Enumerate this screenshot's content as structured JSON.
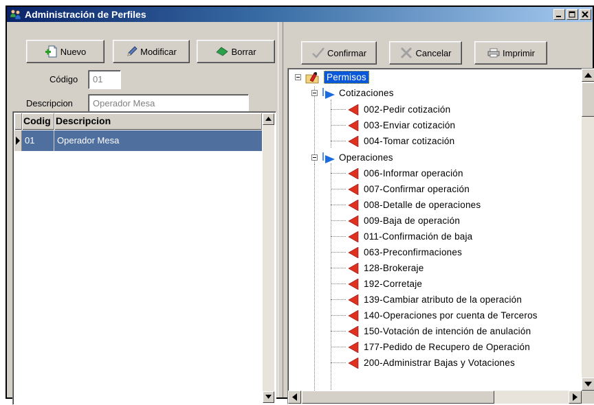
{
  "window": {
    "title": "Administración de Perfiles",
    "title_icon": "users-icon",
    "controls": [
      "minimize-icon",
      "restore-icon",
      "close-icon"
    ]
  },
  "left_toolbar": {
    "nuevo": "Nuevo",
    "modificar": "Modificar",
    "borrar": "Borrar"
  },
  "form": {
    "codigo_label": "Código",
    "codigo_value": "01",
    "descripcion_label": "Descripcion",
    "descripcion_value": "Operador Mesa"
  },
  "grid": {
    "columns": [
      "Codig",
      "Descripcion"
    ],
    "rows": [
      {
        "codigo": "01",
        "descripcion": "Operador Mesa",
        "selected": true
      }
    ]
  },
  "right_toolbar": {
    "confirmar": "Confirmar",
    "cancelar": "Cancelar",
    "imprimir": "Imprimir"
  },
  "tree": {
    "root": "Permisos",
    "groups": [
      {
        "label": "Cotizaciones",
        "items": [
          "002-Pedir cotización",
          "003-Enviar cotización",
          "004-Tomar cotización"
        ]
      },
      {
        "label": "Operaciones",
        "items": [
          "006-Informar operación",
          "007-Confirmar operación",
          "008-Detalle de operaciones",
          "009-Baja de operación",
          "011-Confirmación de baja",
          "063-Preconfirmaciones",
          "128-Brokeraje",
          "192-Corretaje",
          "139-Cambiar atributo de la operación",
          "140-Operaciones por cuenta de Terceros",
          "150-Votación de intención de anulación",
          "177-Pedido de Recupero de Operación",
          "200-Administrar Bajas y Votaciones"
        ]
      }
    ]
  },
  "colors": {
    "selection": "#4f6f9f",
    "root_highlight": "#0a58d8",
    "item_icon": "#e03020",
    "group_icon": "#1a6ae0"
  }
}
